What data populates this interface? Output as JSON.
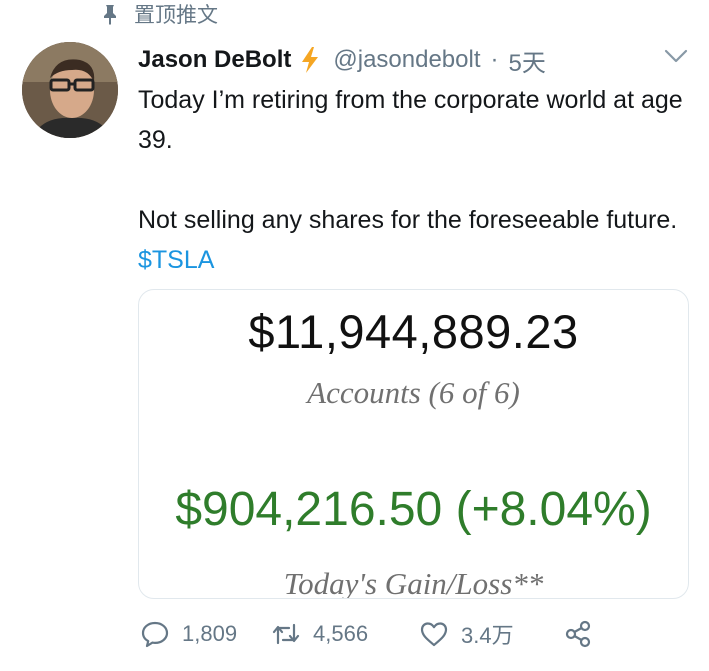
{
  "pinned": {
    "label": "置顶推文",
    "icon": "pin-icon"
  },
  "tweet": {
    "author": {
      "name": "Jason DeBolt",
      "handle": "@jasondebolt",
      "badge_icon": "lightning-bolt-icon",
      "avatar": "avatar"
    },
    "separator": "·",
    "time": "5天",
    "text_line1": "Today I’m retiring from the corporate world at age 39.",
    "text_line2": "Not selling any shares for the foreseeable future.",
    "cashtag": "$TSLA",
    "media": {
      "balance": "$11,944,889.23",
      "accounts_label": "Accounts (6 of 6)",
      "gain": "$904,216.50 (+8.04%)",
      "gain_label": "Today's Gain/Loss**"
    },
    "actions": {
      "replies": "1,809",
      "retweets": "4,566",
      "likes": "3.4万"
    }
  },
  "colors": {
    "cashtag": "#1b95e0",
    "bolt": "#f5a623",
    "gain": "#2f7d2b",
    "muted": "#657786"
  }
}
